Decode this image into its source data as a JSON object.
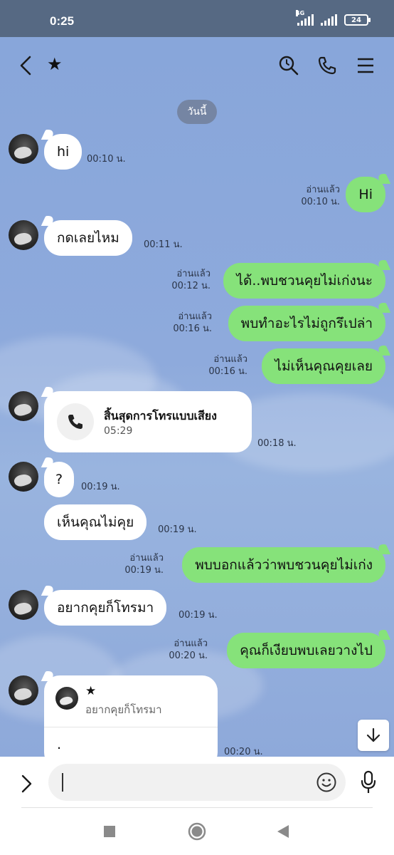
{
  "status_bar": {
    "time": "0:25",
    "network": "4G",
    "battery": "24"
  },
  "header": {
    "contact_name": "★",
    "icons": [
      "back-icon",
      "search-icon",
      "phone-icon",
      "menu-icon"
    ]
  },
  "date_separator": "วันนี้",
  "messages": [
    {
      "side": "in",
      "text": "hi",
      "time": "00:10 น."
    },
    {
      "side": "out",
      "text": "Hi",
      "read": "อ่านแล้ว",
      "time": "00:10 น."
    },
    {
      "side": "in",
      "text": "กดเลยไหม",
      "time": "00:11 น."
    },
    {
      "side": "out",
      "text": "ได้..พบชวนคุยไม่เก่งนะ",
      "read": "อ่านแล้ว",
      "time": "00:12 น."
    },
    {
      "side": "out",
      "text": "พบทำอะไรไม่ถูกรึเปล่า",
      "read": "อ่านแล้ว",
      "time": "00:16 น."
    },
    {
      "side": "out",
      "text": "ไม่เห็นคุณคุยเลย",
      "read": "อ่านแล้ว",
      "time": "00:16 น."
    },
    {
      "side": "in",
      "type": "call",
      "title": "สิ้นสุดการโทรแบบเสียง",
      "duration": "05:29",
      "time": "00:18 น."
    },
    {
      "side": "in",
      "text": "?",
      "time": "00:19 น."
    },
    {
      "side": "in",
      "text": "เห็นคุณไม่คุย",
      "time": "00:19 น."
    },
    {
      "side": "out",
      "text": "พบบอกแล้วว่าพบชวนคุยไม่เก่ง",
      "read": "อ่านแล้ว",
      "time": "00:19 น."
    },
    {
      "side": "in",
      "text": "อยากคุยก็โทรมา",
      "time": "00:19 น."
    },
    {
      "side": "out",
      "text": "คุณก็เงียบพบเลยวางไป",
      "read": "อ่านแล้ว",
      "time": "00:20 น."
    },
    {
      "side": "in",
      "type": "reply",
      "reply_name": "★",
      "reply_text": "อยากคุยก็โทรมา",
      "text": ".",
      "time": "00:20 น."
    }
  ],
  "input": {
    "value": "",
    "placeholder": ""
  },
  "colors": {
    "chat_background": "#8aa6d8",
    "outgoing_bubble": "#86e27a",
    "incoming_bubble": "#ffffff",
    "status_bar": "#566983"
  }
}
